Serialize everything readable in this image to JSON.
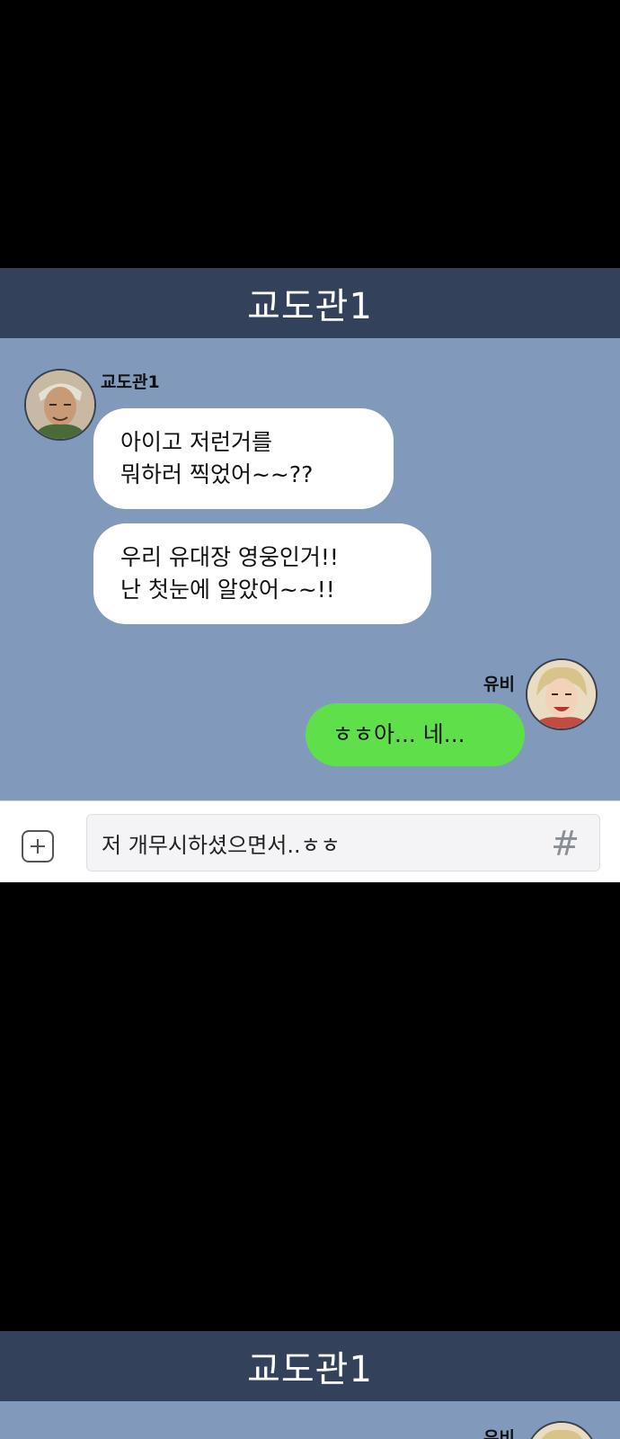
{
  "chat": {
    "title": "교도관1",
    "messages": [
      {
        "sender": "교도관1",
        "lines": [
          "아이고 저런거를",
          "뭐하러 찍었어~~??"
        ],
        "direction": "incoming"
      },
      {
        "sender": "교도관1",
        "lines": [
          "우리 유대장 영웅인거!!",
          "난 첫눈에 알았어~~!!"
        ],
        "direction": "incoming"
      },
      {
        "sender": "유비",
        "lines": [
          "ㅎㅎ아... 네..."
        ],
        "direction": "outgoing"
      }
    ],
    "input": {
      "value": "저 개무시하셨으면서..ㅎㅎ"
    },
    "icons": {
      "attach": "plus-icon",
      "hashtag": "hash-icon"
    }
  },
  "next_panel": {
    "title": "교도관1",
    "sender_partial": "유비"
  },
  "colors": {
    "header": "#34415b",
    "chat_background": "#8199bb",
    "incoming_bubble": "#ffffff",
    "outgoing_bubble": "#5fe04a",
    "page_background": "#000000"
  }
}
